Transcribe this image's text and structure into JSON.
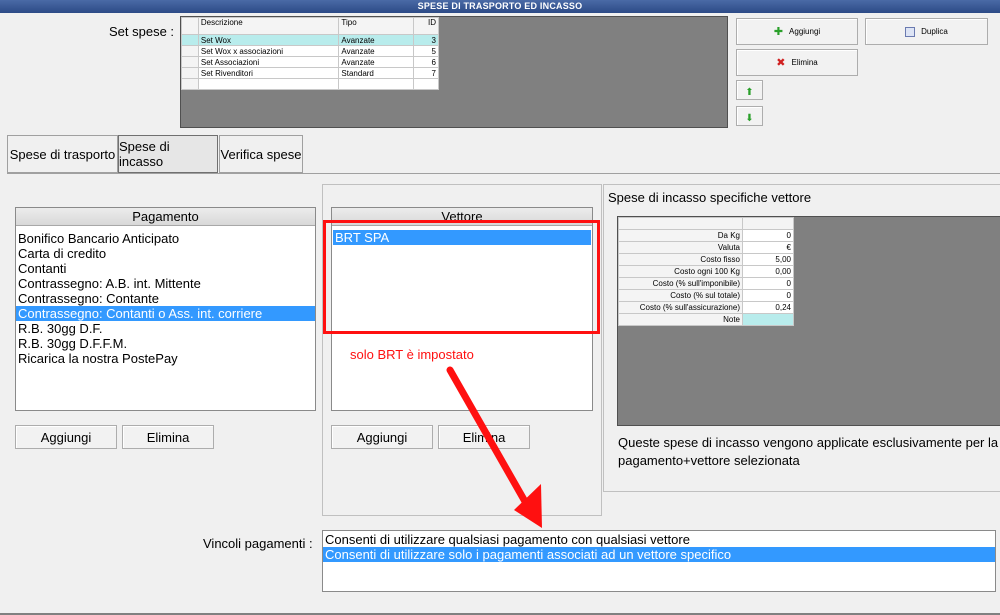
{
  "window": {
    "title": "SPESE DI TRASPORTO ED INCASSO"
  },
  "set_spese": {
    "label": "Set spese :",
    "columns": [
      "Descrizione",
      "Tipo",
      "ID"
    ],
    "rows": [
      {
        "descr": "Set Wox",
        "tipo": "Avanzate",
        "id": "3"
      },
      {
        "descr": "Set Wox x associazioni",
        "tipo": "Avanzate",
        "id": "5"
      },
      {
        "descr": "Set Associazioni",
        "tipo": "Avanzate",
        "id": "6"
      },
      {
        "descr": "Set Rivenditori",
        "tipo": "Standard",
        "id": "7"
      }
    ],
    "aggiungi": "Aggiungi",
    "duplica": "Duplica",
    "elimina": "Elimina"
  },
  "tabs": [
    "Spese di trasporto",
    "Spese di incasso",
    "Verifica spese"
  ],
  "pagamento": {
    "header": "Pagamento",
    "items": [
      "Bonifico Bancario Anticipato",
      "Carta di credito",
      "Contanti",
      "Contrassegno: A.B. int. Mittente",
      "Contrassegno: Contante",
      "Contrassegno: Contanti o Ass. int. corriere",
      "R.B. 30gg D.F.",
      "R.B. 30gg D.F.F.M.",
      "Ricarica la nostra PostePay"
    ],
    "aggiungi": "Aggiungi",
    "elimina": "Elimina"
  },
  "vettore": {
    "header": "Vettore",
    "items": [
      "BRT SPA"
    ],
    "aggiungi": "Aggiungi",
    "elimina": "Elimina"
  },
  "annotation": "solo BRT è impostato",
  "spese_vettore": {
    "title": "Spese di incasso specifiche vettore",
    "rows": [
      {
        "label": "Da Kg",
        "value": "0"
      },
      {
        "label": "Valuta",
        "value": "€"
      },
      {
        "label": "Costo fisso",
        "value": "5,00"
      },
      {
        "label": "Costo ogni 100 Kg",
        "value": "0,00"
      },
      {
        "label": "Costo (% sull'imponibile)",
        "value": "0"
      },
      {
        "label": "Costo (% sul totale)",
        "value": "0"
      },
      {
        "label": "Costo (% sull'assicurazione)",
        "value": "0,24"
      },
      {
        "label": "Note",
        "value": ""
      }
    ],
    "info_line1": "Queste spese di incasso vengono applicate esclusivamente per la co",
    "info_line2": "pagamento+vettore selezionata"
  },
  "vincoli": {
    "label": "Vincoli pagamenti :",
    "items": [
      "Consenti di utilizzare qualsiasi pagamento con qualsiasi vettore",
      "Consenti di utilizzare solo i pagamenti associati ad un vettore specifico"
    ]
  },
  "colors": {
    "selection": "#3399ff",
    "grid_selection": "#b8ecec",
    "annotation": "#ff1010",
    "titlebar": "#2c4a86"
  }
}
